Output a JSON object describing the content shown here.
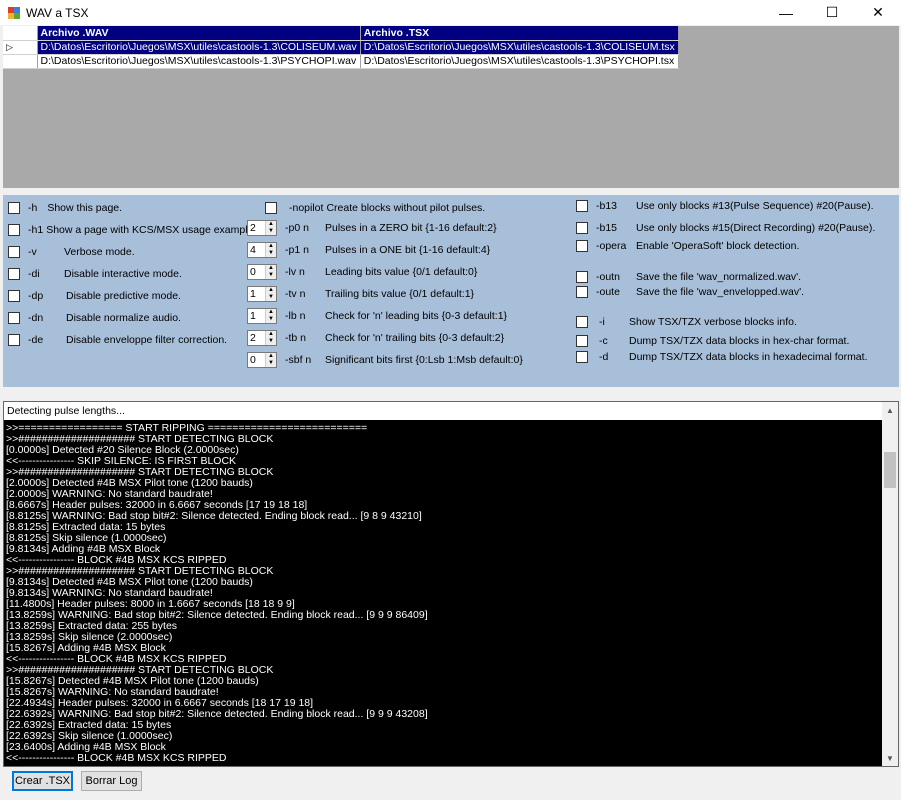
{
  "window": {
    "title": "WAV a TSX"
  },
  "grid": {
    "columns": [
      "Archivo .WAV",
      "Archivo .TSX"
    ],
    "rows": [
      {
        "wav": "D:\\Datos\\Escritorio\\Juegos\\MSX\\utiles\\castools-1.3\\COLISEUM.wav",
        "tsx": "D:\\Datos\\Escritorio\\Juegos\\MSX\\utiles\\castools-1.3\\COLISEUM.tsx"
      },
      {
        "wav": "D:\\Datos\\Escritorio\\Juegos\\MSX\\utiles\\castools-1.3\\PSYCHOPI.wav",
        "tsx": "D:\\Datos\\Escritorio\\Juegos\\MSX\\utiles\\castools-1.3\\PSYCHOPI.tsx"
      }
    ]
  },
  "options": {
    "col1": [
      {
        "flag": "-h",
        "label": "Show this page."
      },
      {
        "flag": "-h1",
        "label": "Show a page with KCS/MSX usage examples."
      },
      {
        "flag": "-v",
        "label": "Verbose mode."
      },
      {
        "flag": "-di",
        "label": "Disable interactive mode."
      },
      {
        "flag": "-dp",
        "label": "Disable predictive mode."
      },
      {
        "flag": "-dn",
        "label": "Disable normalize audio."
      },
      {
        "flag": "-de",
        "label": "Disable enveloppe filter correction."
      }
    ],
    "nopilot": {
      "flag": "-nopilot",
      "label": "Create blocks without pilot pulses."
    },
    "spins": [
      {
        "value": "2",
        "flag": "-p0 n",
        "label": "Pulses in a ZERO bit {1-16 default:2}"
      },
      {
        "value": "4",
        "flag": "-p1 n",
        "label": "Pulses in a ONE bit {1-16 default:4}"
      },
      {
        "value": "0",
        "flag": "-lv n",
        "label": "Leading bits value {0/1 default:0}"
      },
      {
        "value": "1",
        "flag": "-tv n",
        "label": "Trailing bits value {0/1 default:1}"
      },
      {
        "value": "1",
        "flag": "-lb n",
        "label": "Check for 'n' leading bits {0-3 default:1}"
      },
      {
        "value": "2",
        "flag": "-tb n",
        "label": "Check for 'n' trailing bits {0-3 default:2}"
      },
      {
        "value": "0",
        "flag": "-sbf n",
        "label": "Significant bits first {0:Lsb 1:Msb default:0}"
      }
    ],
    "col3": [
      {
        "flag": "-b13",
        "label": "Use only blocks #13(Pulse Sequence)  #20(Pause)."
      },
      {
        "flag": "-b15",
        "label": "Use only blocks #15(Direct Recording)  #20(Pause)."
      },
      {
        "flag": "-opera",
        "label": "Enable 'OperaSoft' block detection."
      },
      {
        "flag": "-outn",
        "label": "Save the file 'wav_normalized.wav'."
      },
      {
        "flag": "-oute",
        "label": "Save the file 'wav_envelopped.wav'."
      },
      {
        "flag": "-i",
        "label": "Show TSX/TZX verbose blocks info."
      },
      {
        "flag": "-c",
        "label": "Dump TSX/TZX data blocks in hex-char format."
      },
      {
        "flag": "-d",
        "label": "Dump TSX/TZX data blocks in hexadecimal format."
      }
    ]
  },
  "console": {
    "header": "Detecting pulse lengths...",
    "lines": [
      "",
      ">>================= START RIPPING ==========================",
      ">>#################### START DETECTING BLOCK",
      "[0.0000s] Detected #20 Silence Block (2.0000sec)",
      "<<---------------- SKIP SILENCE: IS FIRST BLOCK",
      ">>#################### START DETECTING BLOCK",
      "[2.0000s] Detected #4B MSX Pilot tone (1200 bauds)",
      "[2.0000s] WARNING: No standard baudrate!",
      "[8.6667s] Header pulses: 32000 in 6.6667 seconds [17 19 18 18]",
      "[8.8125s] WARNING: Bad stop bit#2: Silence detected. Ending block read... [9 8 9 43210]",
      "[8.8125s] Extracted data: 15 bytes",
      "[8.8125s] Skip silence (1.0000sec)",
      "[9.8134s] Adding #4B MSX Block",
      "<<---------------- BLOCK #4B MSX KCS RIPPED",
      ">>#################### START DETECTING BLOCK",
      "[9.8134s] Detected #4B MSX Pilot tone (1200 bauds)",
      "[9.8134s] WARNING: No standard baudrate!",
      "[11.4800s] Header pulses: 8000 in 1.6667 seconds [18 18 9 9]",
      "[13.8259s] WARNING: Bad stop bit#2: Silence detected. Ending block read... [9 9 9 86409]",
      "[13.8259s] Extracted data: 255 bytes",
      "[13.8259s] Skip silence (2.0000sec)",
      "[15.8267s] Adding #4B MSX Block",
      "<<---------------- BLOCK #4B MSX KCS RIPPED",
      ">>#################### START DETECTING BLOCK",
      "[15.8267s] Detected #4B MSX Pilot tone (1200 bauds)",
      "[15.8267s] WARNING: No standard baudrate!",
      "[22.4934s] Header pulses: 32000 in 6.6667 seconds [18 17 19 18]",
      "[22.6392s] WARNING: Bad stop bit#2: Silence detected. Ending block read... [9 9 9 43208]",
      "[22.6392s] Extracted data: 15 bytes",
      "[22.6392s] Skip silence (1.0000sec)",
      "[23.6400s] Adding #4B MSX Block",
      "<<---------------- BLOCK #4B MSX KCS RIPPED"
    ]
  },
  "buttons": {
    "create": "Crear .TSX",
    "clear": "Borrar Log"
  }
}
